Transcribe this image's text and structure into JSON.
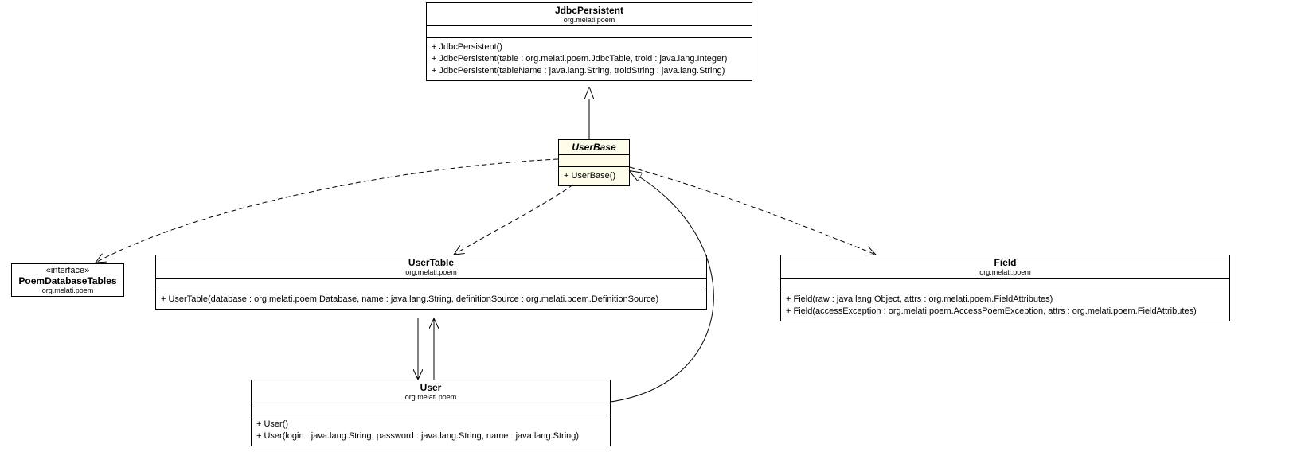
{
  "classes": {
    "jdbcPersistent": {
      "name": "JdbcPersistent",
      "package": "org.melati.poem",
      "ops": [
        "+ JdbcPersistent()",
        "+ JdbcPersistent(table : org.melati.poem.JdbcTable, troid : java.lang.Integer)",
        "+ JdbcPersistent(tableName : java.lang.String, troidString : java.lang.String)"
      ]
    },
    "userBase": {
      "name": "UserBase",
      "abstract": true,
      "ops": [
        "+ UserBase()"
      ]
    },
    "poemDatabaseTables": {
      "stereotype": "«interface»",
      "name": "PoemDatabaseTables",
      "package": "org.melati.poem"
    },
    "userTable": {
      "name": "UserTable",
      "package": "org.melati.poem",
      "ops": [
        "+ UserTable(database : org.melati.poem.Database, name : java.lang.String, definitionSource : org.melati.poem.DefinitionSource)"
      ]
    },
    "field": {
      "name": "Field",
      "package": "org.melati.poem",
      "ops": [
        "+ Field(raw : java.lang.Object, attrs : org.melati.poem.FieldAttributes)",
        "+ Field(accessException : org.melati.poem.AccessPoemException, attrs : org.melati.poem.FieldAttributes)"
      ]
    },
    "user": {
      "name": "User",
      "package": "org.melati.poem",
      "ops": [
        "+ User()",
        "+ User(login : java.lang.String, password : java.lang.String, name : java.lang.String)"
      ]
    }
  }
}
